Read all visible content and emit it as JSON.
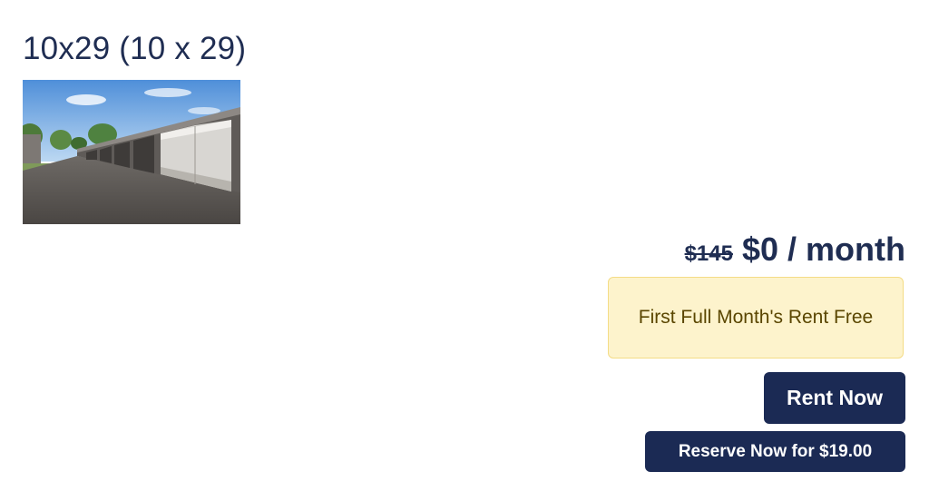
{
  "unit": {
    "title": "10x29 (10 x 29)",
    "photo_alt": "Outdoor storage unit building with an open roll-up door"
  },
  "pricing": {
    "original_price": "$145",
    "current_price": "$0 / month"
  },
  "promotion": {
    "text": "First Full Month's Rent Free"
  },
  "actions": {
    "rent_label": "Rent Now",
    "reserve_label": "Reserve Now for $19.00"
  },
  "colors": {
    "brand_navy": "#1b2a54",
    "title_text": "#1f2d52",
    "promo_background": "#fdf3cc",
    "promo_border": "#f4dc86",
    "promo_text": "#5a4600"
  }
}
